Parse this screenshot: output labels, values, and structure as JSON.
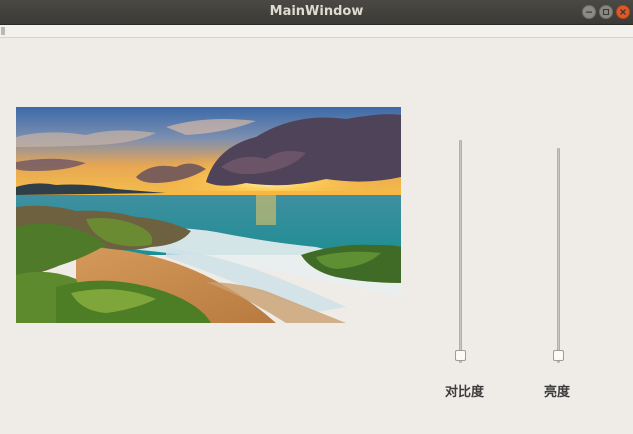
{
  "window": {
    "title": "MainWindow",
    "buttons": [
      "minimize",
      "maximize",
      "close"
    ]
  },
  "image": {
    "description": "",
    "icon": "beach-sunset-photo"
  },
  "sliders": [
    {
      "id": "contrast",
      "label": "对比度",
      "value_fraction": 0.0
    },
    {
      "id": "brightness",
      "label": "亮度",
      "value_fraction": 0.0
    }
  ],
  "colors": {
    "window_bg": "#efebe7",
    "titlebar": "#3b3a36",
    "close_button": "#e0592b"
  }
}
